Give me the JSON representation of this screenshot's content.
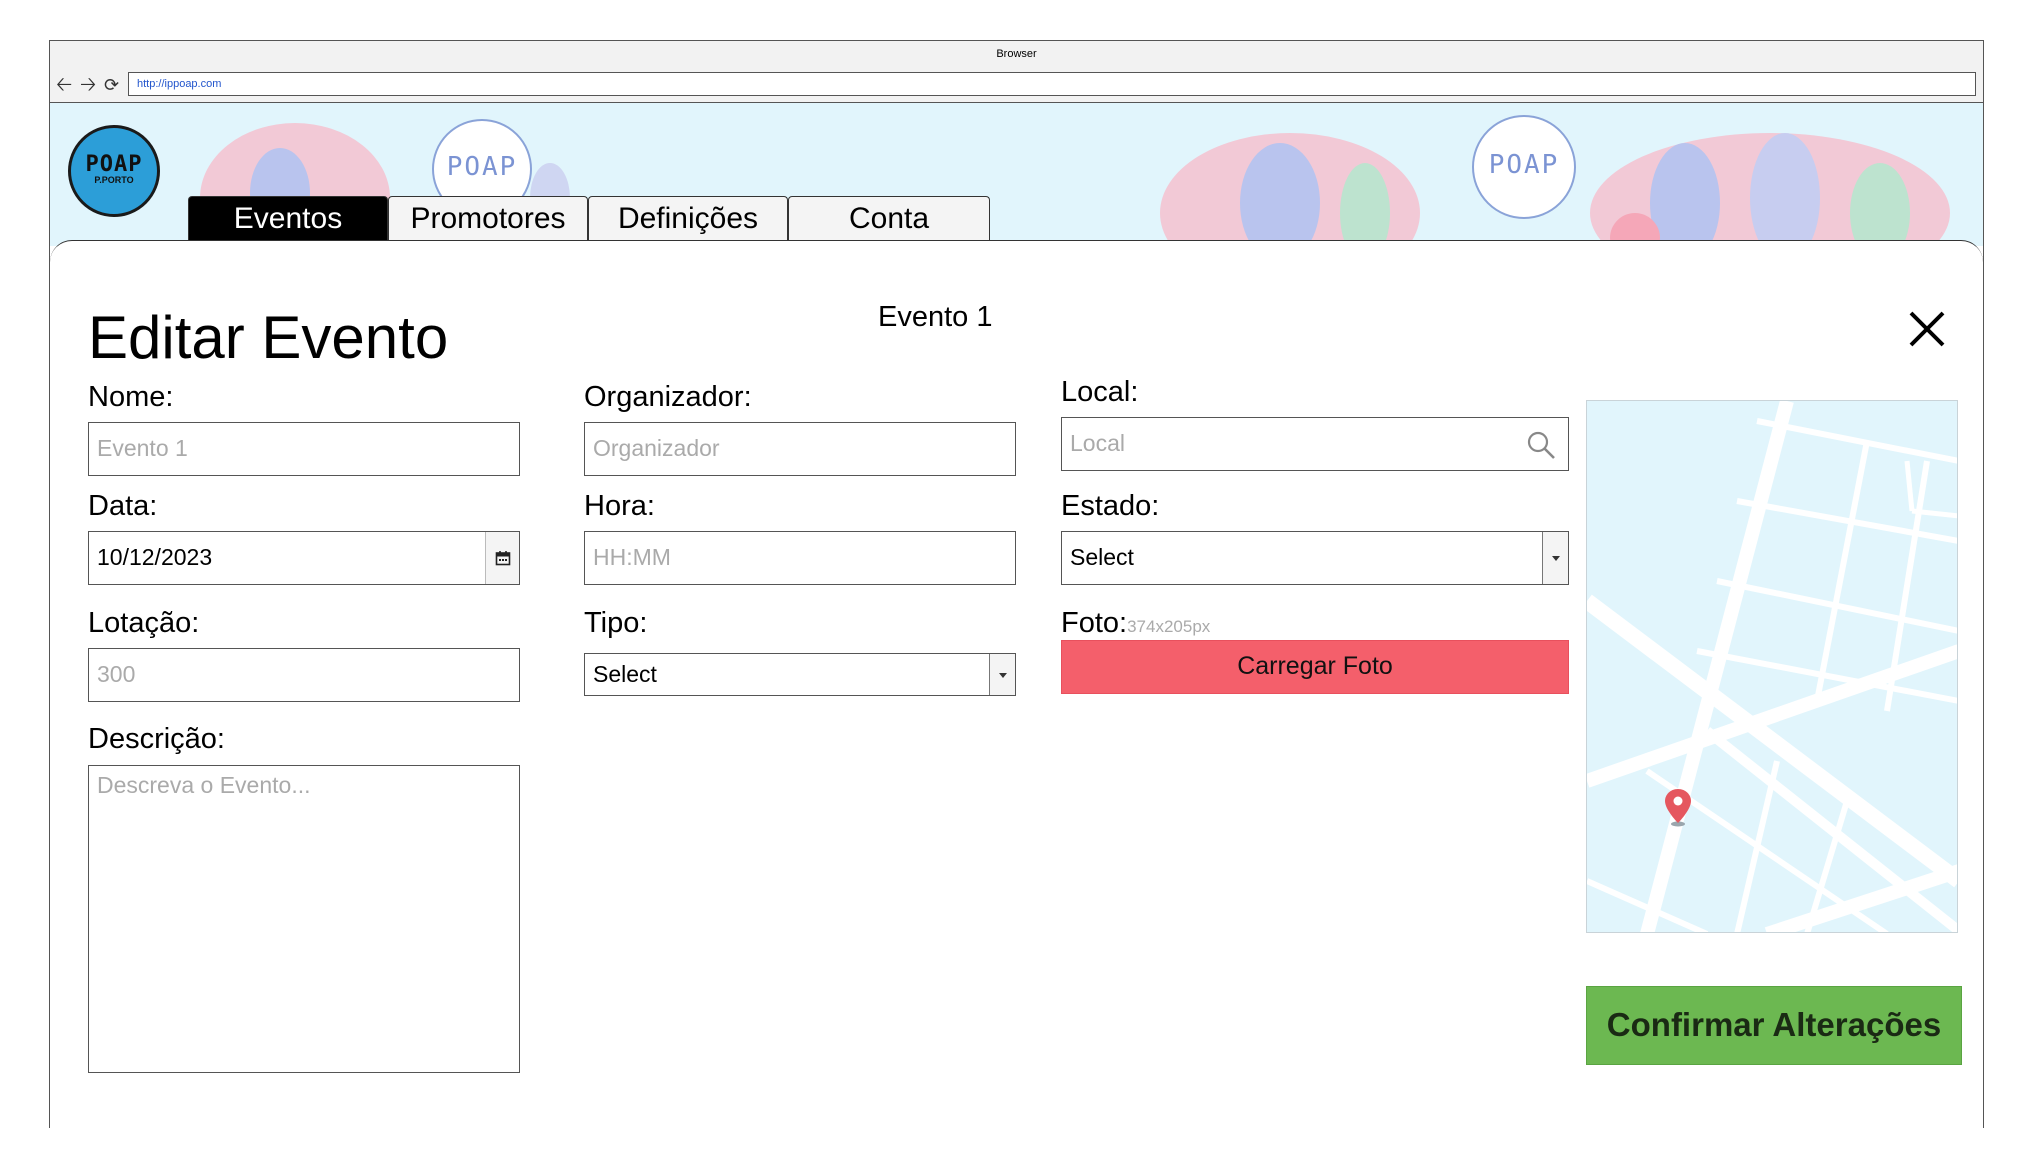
{
  "browser": {
    "title": "Browser",
    "url": "http://ippoap.com"
  },
  "logo": {
    "main": "POAP",
    "sub": "P.PORTO"
  },
  "banner": {
    "badge_text": "POAP"
  },
  "tabs": [
    {
      "label": "Eventos",
      "active": true
    },
    {
      "label": "Promotores",
      "active": false
    },
    {
      "label": "Definições",
      "active": false
    },
    {
      "label": "Conta",
      "active": false
    }
  ],
  "form": {
    "page_title": "Editar Evento",
    "event_name": "Evento 1",
    "nome": {
      "label": "Nome:",
      "placeholder": "Evento 1"
    },
    "organizador": {
      "label": "Organizador:",
      "placeholder": "Organizador"
    },
    "local": {
      "label": "Local:",
      "placeholder": "Local"
    },
    "data": {
      "label": "Data:",
      "value": "10/12/2023"
    },
    "hora": {
      "label": "Hora:",
      "placeholder": "HH:MM"
    },
    "estado": {
      "label": "Estado:",
      "value": "Select"
    },
    "lotacao": {
      "label": "Lotação:",
      "placeholder": "300"
    },
    "tipo": {
      "label": "Tipo:",
      "value": "Select"
    },
    "foto": {
      "label": "Foto:",
      "hint": "374x205px",
      "button": "Carregar Foto"
    },
    "descricao": {
      "label": "Descrição:",
      "placeholder": "Descreva o Evento..."
    },
    "confirm_button": "Confirmar Alterações"
  },
  "colors": {
    "banner_bg": "#e1f5fc",
    "upload_button": "#f45f6b",
    "confirm_button": "#6cb851",
    "map_pin": "#e5575f",
    "active_tab": "#000000"
  },
  "icons": [
    "back-arrow-icon",
    "forward-arrow-icon",
    "reload-icon",
    "close-icon",
    "search-icon",
    "calendar-icon",
    "map-pin-icon"
  ]
}
